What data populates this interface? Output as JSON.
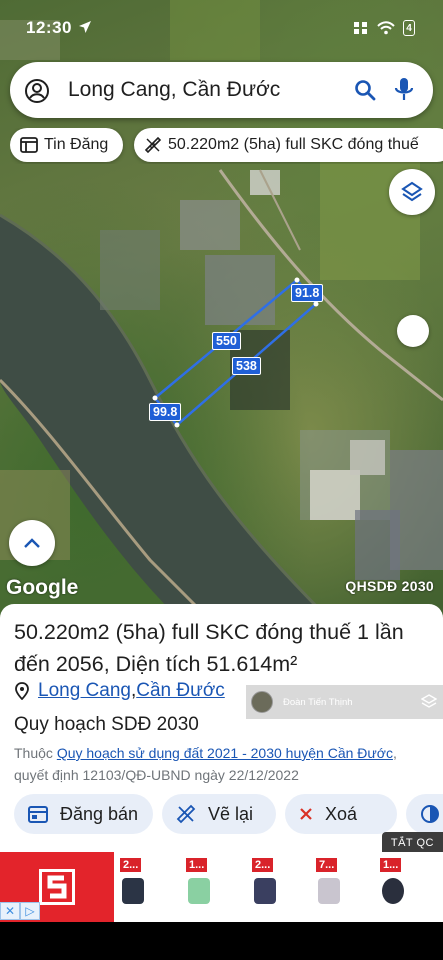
{
  "status_bar": {
    "time": "12:30",
    "battery": "4"
  },
  "search": {
    "query": "Long Cang, Cần Đước"
  },
  "chips": [
    {
      "icon": "newspaper-icon",
      "label": "Tin Đăng"
    },
    {
      "icon": "ruler-icon",
      "label": "50.220m2 (5ha) full SKC đóng thuế"
    }
  ],
  "map": {
    "measurements": [
      "91.8",
      "550",
      "538",
      "99.8"
    ],
    "google_logo": "Google",
    "layer_label": "QHSDĐ 2030"
  },
  "listing": {
    "title_main": "50.220m2 (5ha) full SKC đóng thuế 1 lần đến 2056",
    "title_area_prefix": ", Diện tích ",
    "title_area_value": "51.614m²",
    "location_1": "Long Cang",
    "location_sep": ", ",
    "location_2": "Cần Đước",
    "location_tail": "",
    "plan_heading": "Quy hoạch SDĐ 2030",
    "desc_prefix": "Thuộc ",
    "desc_link": "Quy hoạch sử dụng đất 2021 - 2030 huyện Cần Đước",
    "desc_suffix": ", quyết định 12103/QĐ-UBND ngày 22/12/2022"
  },
  "user": {
    "name": "Đoàn Tiến Thịnh"
  },
  "actions": [
    {
      "icon": "calendar-icon",
      "label": "Đăng bán"
    },
    {
      "icon": "ruler-icon",
      "label": "Vẽ lại"
    },
    {
      "icon": "close-icon",
      "label": "Xoá"
    },
    {
      "icon": "half-circle-icon",
      "label": ""
    }
  ],
  "ad": {
    "close_label": "TẮT QC",
    "prices": [
      "2...",
      "1...",
      "2...",
      "7...",
      "1..."
    ]
  },
  "colors": {
    "accent": "#1a56b4",
    "measure": "#1f5fd6",
    "ad_red": "#e3242b"
  }
}
